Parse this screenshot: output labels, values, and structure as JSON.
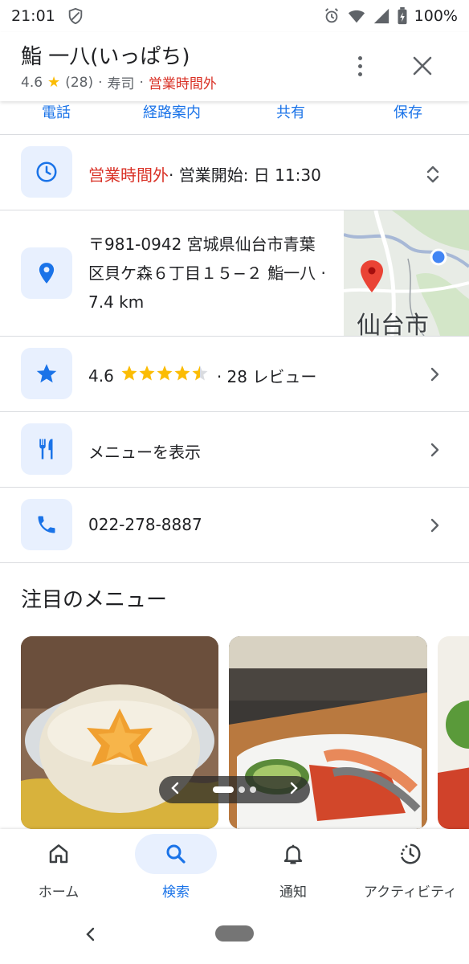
{
  "status_bar": {
    "time": "21:01",
    "battery": "100%"
  },
  "header": {
    "title": "鮨 一八(いっぱち)",
    "rating": "4.6",
    "review_count": "(28)",
    "category": "寿司",
    "status": "営業時間外",
    "separator": "·"
  },
  "actions": [
    "電話",
    "経路案内",
    "共有",
    "保存"
  ],
  "hours": {
    "status": "営業時間外",
    "next_open": "· 営業開始: 日 11:30"
  },
  "address": {
    "text": "〒981-0942 宮城県仙台市青葉区貝ケ森６丁目１５−２ 鮨一八 · 7.4 km",
    "map_label": "仙台市"
  },
  "reviews": {
    "rating": "4.6",
    "stars": "★★★★½",
    "star_count": 4.6,
    "summary": "· 28 レビュー"
  },
  "menu_row": {
    "label": "メニューを表示"
  },
  "phone_row": {
    "number": "022-278-8887"
  },
  "featured": {
    "title": "注目のメニュー"
  },
  "bottom_nav": [
    {
      "label": "ホーム",
      "icon": "home-icon"
    },
    {
      "label": "検索",
      "icon": "search-icon"
    },
    {
      "label": "通知",
      "icon": "bell-icon"
    },
    {
      "label": "アクティビティ",
      "icon": "activity-icon"
    }
  ],
  "colors": {
    "accent": "#1a73e8",
    "closed": "#d93025",
    "star": "#fbbc04",
    "icon_bg": "#e8f0fe"
  }
}
